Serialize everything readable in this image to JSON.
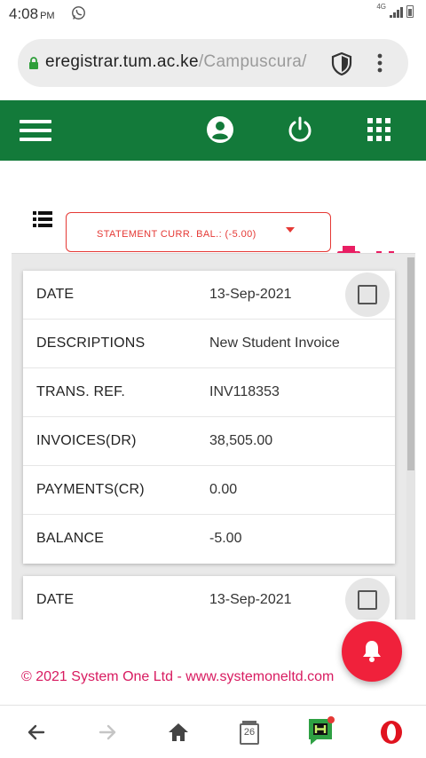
{
  "status_bar": {
    "time": "4:08",
    "ampm": "PM",
    "network": "4G"
  },
  "browser": {
    "url_host": "eregistrar.tum.ac.ke",
    "url_path": "/Campuscura/",
    "tabs_count": "26"
  },
  "statement": {
    "label": "STATEMENT CURR. BAL.: (-5.00)"
  },
  "cards": [
    {
      "rows": [
        {
          "label": "DATE",
          "value": "13-Sep-2021"
        },
        {
          "label": "DESCRIPTIONS",
          "value": "New Student Invoice"
        },
        {
          "label": "TRANS. REF.",
          "value": "INV118353"
        },
        {
          "label": "INVOICES(DR)",
          "value": "38,505.00"
        },
        {
          "label": "PAYMENTS(CR)",
          "value": "0.00"
        },
        {
          "label": "BALANCE",
          "value": "-5.00"
        }
      ]
    },
    {
      "rows": [
        {
          "label": "DATE",
          "value": "13-Sep-2021"
        }
      ]
    }
  ],
  "footer": {
    "text": "© 2021 System One Ltd - www.systemoneltd.com"
  },
  "colors": {
    "header_green": "#137a3a",
    "accent_red": "#e53935",
    "footer_pink": "#d81b60",
    "fab_red": "#f0213b"
  },
  "icons": {
    "header": [
      "menu-icon",
      "user-icon",
      "power-icon",
      "apps-icon"
    ],
    "toolbar": [
      "list-icon",
      "print-icon",
      "fullscreen-icon"
    ],
    "fab": "bell-icon",
    "nav": [
      "back-arrow-icon",
      "forward-arrow-icon",
      "home-icon",
      "tabs-icon",
      "hype-icon",
      "opera-icon"
    ]
  }
}
